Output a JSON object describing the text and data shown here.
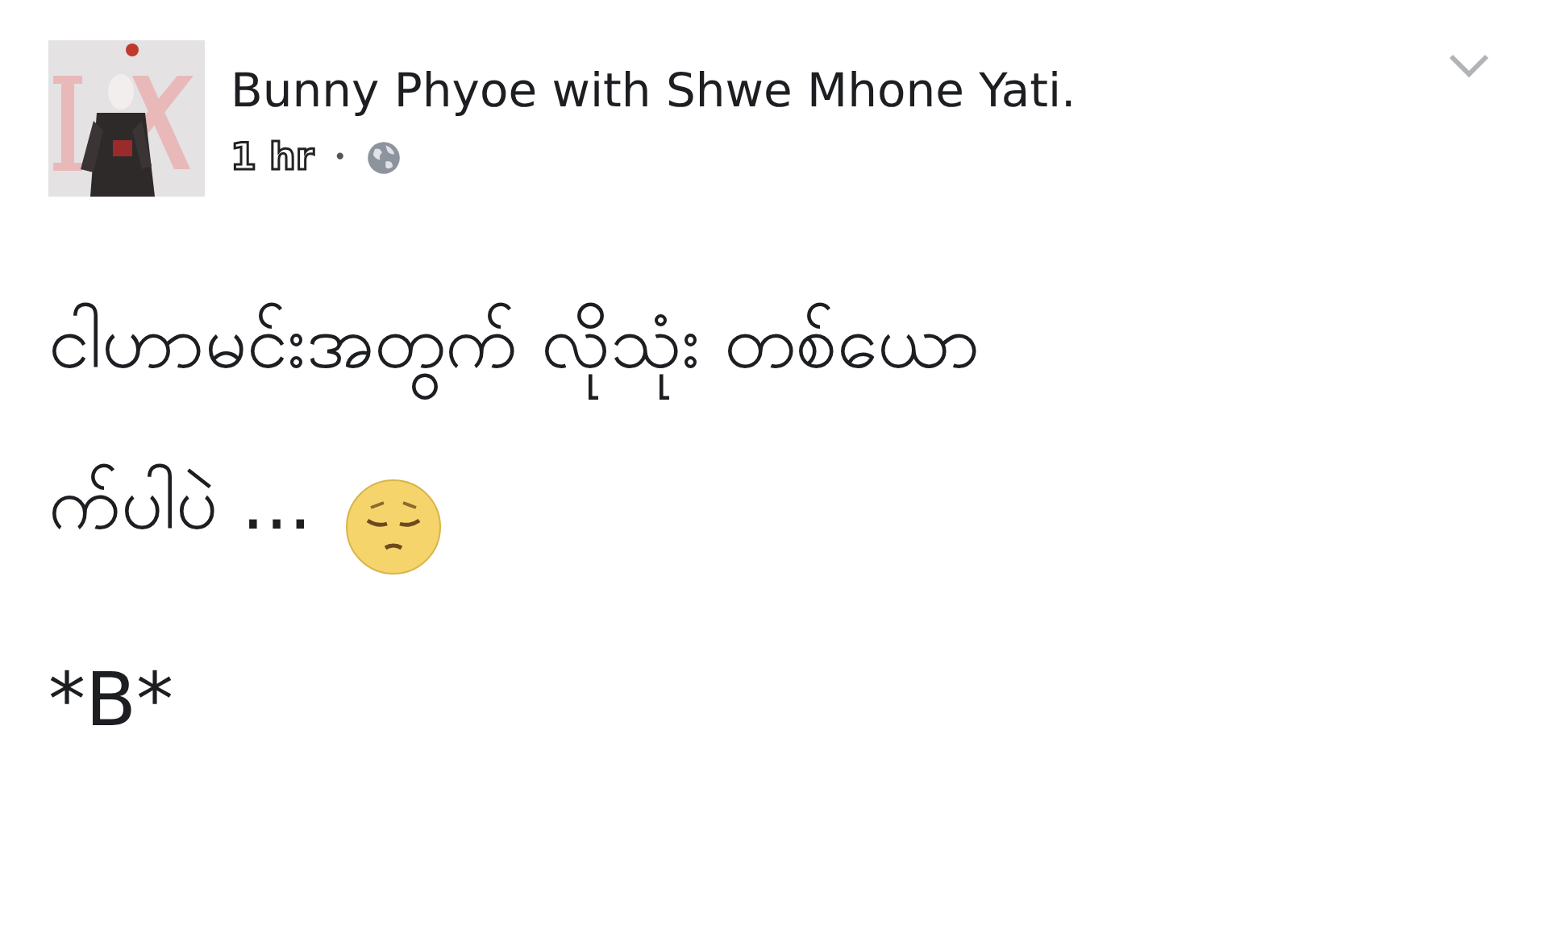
{
  "post": {
    "author": "Bunny Phyoe with Shwe Mhone Yati.",
    "time": "1 hr",
    "separator": "•",
    "body_lines": [
      "ငါဟာမင်းအတွက် လိုသုံး တစ်ယော",
      "က်ပါပဲ ..."
    ],
    "signature": "*B*"
  }
}
